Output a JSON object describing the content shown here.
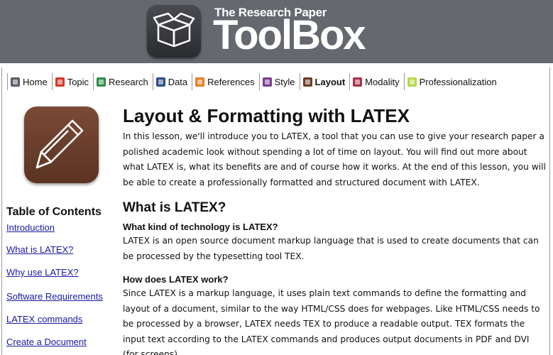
{
  "header": {
    "subtitle": "The Research Paper",
    "title": "ToolBox",
    "logo_icon": "open-box-icon"
  },
  "nav": {
    "items": [
      {
        "label": "Home",
        "icon": "home-icon",
        "color": "#5b5d66",
        "active": false
      },
      {
        "label": "Topic",
        "icon": "topic-icon",
        "color": "#d43a2a",
        "active": false
      },
      {
        "label": "Research",
        "icon": "research-icon",
        "color": "#2f8f4a",
        "active": false
      },
      {
        "label": "Data",
        "icon": "data-icon",
        "color": "#2d4f86",
        "active": false
      },
      {
        "label": "References",
        "icon": "references-icon",
        "color": "#e67e22",
        "active": false
      },
      {
        "label": "Style",
        "icon": "style-icon",
        "color": "#7a3d8e",
        "active": false
      },
      {
        "label": "Layout",
        "icon": "layout-icon",
        "color": "#6b3f2a",
        "active": true
      },
      {
        "label": "Modality",
        "icon": "modality-icon",
        "color": "#a8334a",
        "active": false
      },
      {
        "label": "Professionalization",
        "icon": "professionalization-icon",
        "color": "#b7d94a",
        "active": false
      }
    ]
  },
  "sidebar": {
    "tile_icon": "pencil-icon",
    "toc_title": "Table of Contents",
    "toc_items": [
      "Introduction",
      "What is LATEX?",
      "Why use LATEX?",
      "Software Requirements",
      "LATEX commands",
      "Create a Document"
    ]
  },
  "main": {
    "title": "Layout & Formatting with LATEX",
    "intro": "In this lesson, we'll introduce you to LATEX, a tool that you can use to give your research paper a polished academic look without spending a lot of time on layout. You will find out more about what LATEX is, what its benefits are and of course how it works. At the end of this lesson, you will be able to create a professionally formatted and structured document with LATEX.",
    "section_title": "What is LATEX?",
    "subsections": [
      {
        "heading": "What kind of technology is LATEX?",
        "body": "LATEX is an open source document markup language that is used to create documents that can be processed by the typesetting tool TEX."
      },
      {
        "heading": "How does LATEX work?",
        "body": "Since LATEX is a markup language, it uses plain text commands to define the formatting and layout of a document, similar to the way HTML/CSS does for webpages. Like HTML/CSS needs to be processed by a browser, LATEX needs TEX to produce a readable output. TEX formats the input text according to the LATEX commands and produces output documents in PDF and DVI (for screens)."
      }
    ]
  }
}
